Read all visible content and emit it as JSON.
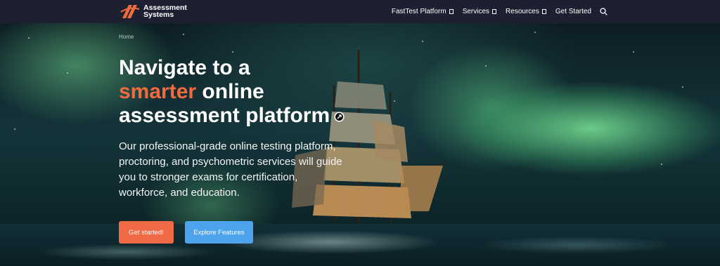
{
  "brand": {
    "line1": "Assessment",
    "line2": "Systems",
    "accent_color": "#f26b3f"
  },
  "nav": {
    "items": [
      {
        "label": "FastTest Platform",
        "has_dropdown": true
      },
      {
        "label": "Services",
        "has_dropdown": true
      },
      {
        "label": "Resources",
        "has_dropdown": true
      },
      {
        "label": "Get Started",
        "has_dropdown": false
      }
    ],
    "search_icon": "search-icon"
  },
  "breadcrumb": {
    "home": "Home"
  },
  "hero": {
    "headline_line1": "Navigate to a",
    "headline_accent": "smarter",
    "headline_line2_rest": " online",
    "headline_line3": "assessment platform",
    "subtext": "Our professional-grade online testing platform, proctoring, and psychometric services will guide you to stronger exams for certification, workforce, and education.",
    "primary_button": "Get started!",
    "secondary_button": "Explore Features",
    "primary_color": "#f06a45",
    "secondary_color": "#4da3ee"
  }
}
